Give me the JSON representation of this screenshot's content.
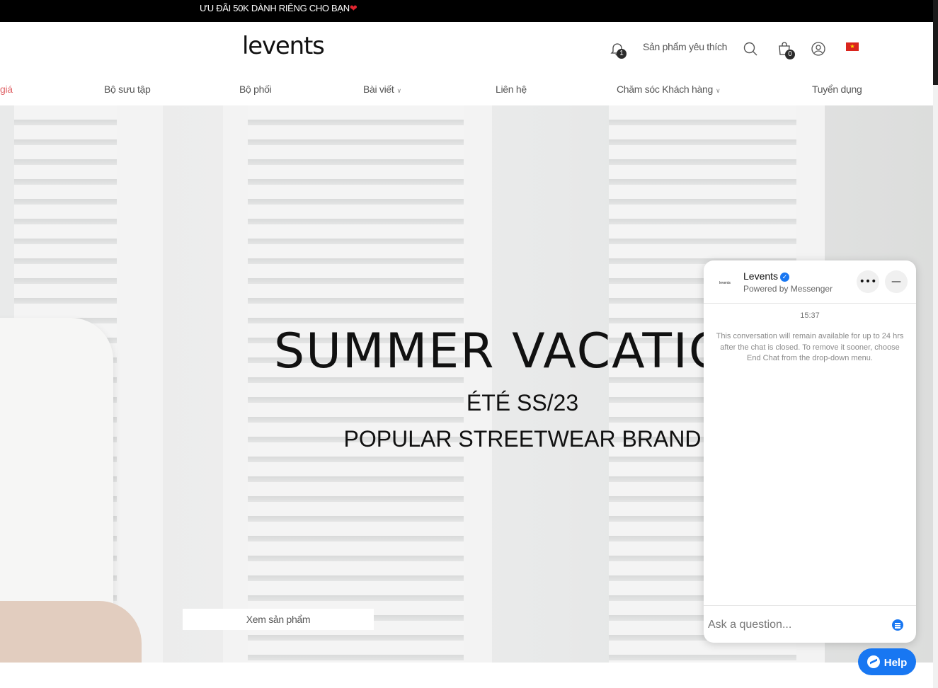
{
  "promo": {
    "text": "ƯU ĐÃI 50K DÀNH RIÊNG CHO BẠN",
    "heart": "❤"
  },
  "header": {
    "logo": "levents",
    "notification_count": "1",
    "favorites_label": "Sản phẩm yêu thích",
    "cart_count": "0",
    "flag_star": "★"
  },
  "nav": {
    "items": [
      {
        "label": "giá"
      },
      {
        "label": "Bộ sưu tập"
      },
      {
        "label": "Bộ phối"
      },
      {
        "label": "Bài viết"
      },
      {
        "label": "Liên hệ"
      },
      {
        "label": "Chăm sóc Khách hàng"
      },
      {
        "label": "Tuyển dụng"
      }
    ]
  },
  "hero": {
    "title": "SUMMER VACATIO",
    "subtitle1": "ÉTÉ  SS/23",
    "subtitle2": "POPULAR STREETWEAR BRAND",
    "cta": "Xem sản phẩm"
  },
  "chat": {
    "logo_text": "levents",
    "name": "Levents",
    "powered_by": "Powered by Messenger",
    "time": "15:37",
    "note": "This conversation will remain available for up to 24 hrs after the chat is closed. To remove it sooner, choose End Chat from the drop-down menu.",
    "input_placeholder": "Ask a question...",
    "more_glyph": "•••",
    "minimize_glyph": "—"
  },
  "help_button": {
    "label": "Help"
  },
  "colors": {
    "accent": "#1877f2",
    "promo_bg": "#000000",
    "nav_highlight": "#e0666a",
    "flag": "#da251d"
  }
}
